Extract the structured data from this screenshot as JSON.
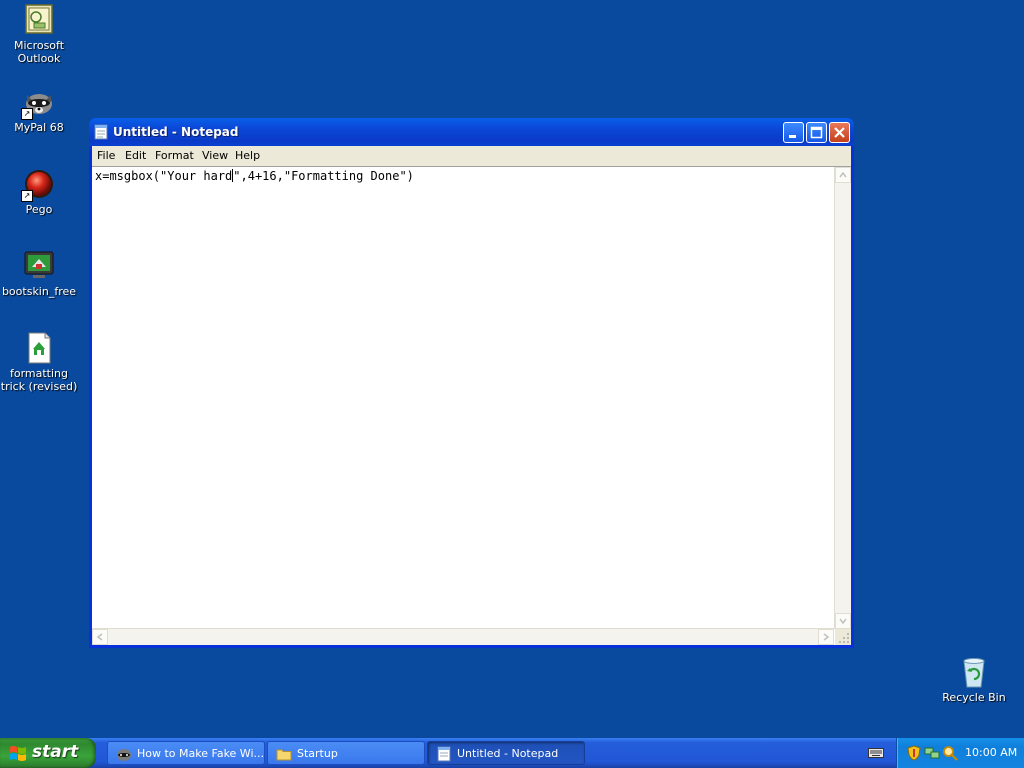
{
  "desktop": {
    "background": "#0a4a9e",
    "icons": [
      {
        "label": "Microsoft Outlook",
        "icon": "outlook-icon"
      },
      {
        "label": "MyPal 68",
        "icon": "raccoon-icon"
      },
      {
        "label": "Pego",
        "icon": "red-ball-icon"
      },
      {
        "label": "bootskin_free",
        "icon": "monitor-icon"
      },
      {
        "label": "formatting trick (revised)",
        "icon": "script-file-icon"
      },
      {
        "label": "Recycle Bin",
        "icon": "recycle-bin-icon"
      }
    ]
  },
  "window": {
    "title": "Untitled - Notepad",
    "menu": [
      "File",
      "Edit",
      "Format",
      "View",
      "Help"
    ],
    "text_before_caret": "x=msgbox(\"Your hard",
    "text_after_caret": "\",4+16,\"Formatting Done\")"
  },
  "taskbar": {
    "start_label": "start",
    "tasks": [
      {
        "label": "How to Make Fake Wi...",
        "icon": "browser-icon"
      },
      {
        "label": "Startup",
        "icon": "folder-icon"
      },
      {
        "label": "Untitled - Notepad",
        "icon": "notepad-icon",
        "active": true
      }
    ],
    "clock": "10:00 AM"
  }
}
